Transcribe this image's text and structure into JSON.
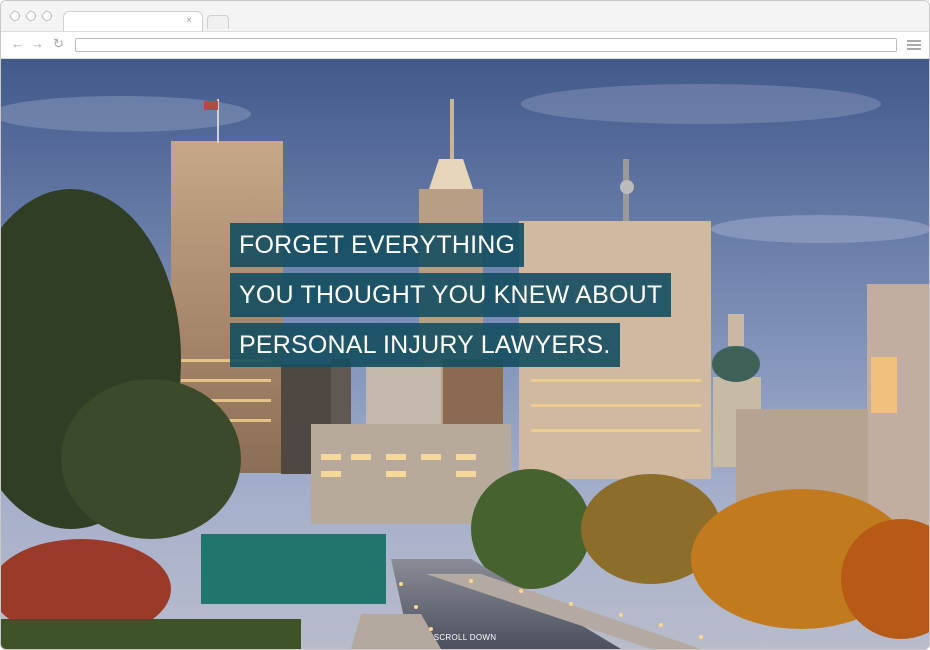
{
  "browser": {
    "tab_close": "×",
    "back_icon": "←",
    "forward_icon": "→",
    "reload_icon": "↻",
    "url": ""
  },
  "hero": {
    "headline_lines": [
      "FORGET EVERYTHING",
      "YOU THOUGHT YOU KNEW ABOUT",
      "PERSONAL INJURY LAWYERS."
    ],
    "scroll_label": "SCROLL DOWN",
    "colors": {
      "headline_bg": "#144e60",
      "headline_text": "#ffffff"
    }
  }
}
